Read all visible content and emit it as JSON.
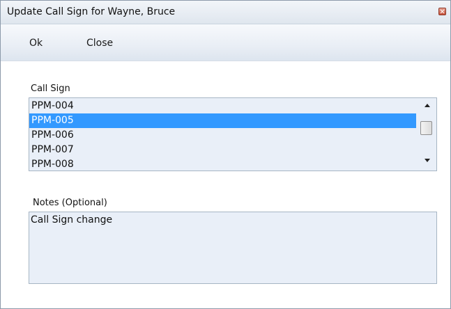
{
  "window": {
    "title": "Update Call Sign for Wayne, Bruce"
  },
  "toolbar": {
    "ok_label": "Ok",
    "close_label": "Close"
  },
  "call_sign": {
    "label": "Call Sign",
    "items": [
      "PPM-004",
      "PPM-005",
      "PPM-006",
      "PPM-007",
      "PPM-008"
    ],
    "selected": "PPM-005"
  },
  "notes": {
    "label": "Notes (Optional)",
    "value": "Call Sign change"
  }
}
